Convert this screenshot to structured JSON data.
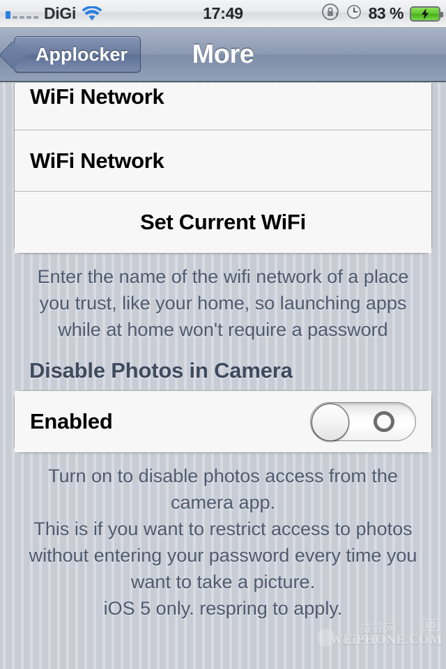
{
  "status_bar": {
    "carrier": "DiGi",
    "signal_bars_total": 5,
    "signal_bars_filled": 1,
    "wifi_icon": "wifi-icon",
    "time": "17:49",
    "rotation_lock_icon": "rotation-lock-icon",
    "alarm_icon": "alarm-clock-icon",
    "battery_percent": "83 %",
    "battery_icon": "battery-charging-icon",
    "accent_color": "#2b7fdd",
    "battery_color": "#5fc62c"
  },
  "nav_bar": {
    "back_label": "Applocker",
    "back_icon": "chevron-left-icon",
    "title": "More"
  },
  "wifi_section": {
    "rows": [
      {
        "label": "WiFi Network",
        "align": "left",
        "clipped": true
      },
      {
        "label": "WiFi Network",
        "align": "left",
        "clipped": false
      },
      {
        "label": "Set Current WiFi",
        "align": "center",
        "clipped": false
      }
    ],
    "footer": "Enter the name of the wifi network of a place you trust, like your home, so launching apps while at home won't require a password"
  },
  "photos_section": {
    "header": "Disable Photos in Camera",
    "row_label": "Enabled",
    "switch_state": "off",
    "switch_off_glyph": "circle-off-icon",
    "footer": "Turn on to disable photos access from the camera app.\nThis is if you want to restrict access to photos without entering your password every time you want to take a picture.\niOS 5 only. respring to apply."
  },
  "watermark": {
    "main": "WEiPHONE.COM",
    "cn": "威锋网",
    "badge": "ID"
  }
}
